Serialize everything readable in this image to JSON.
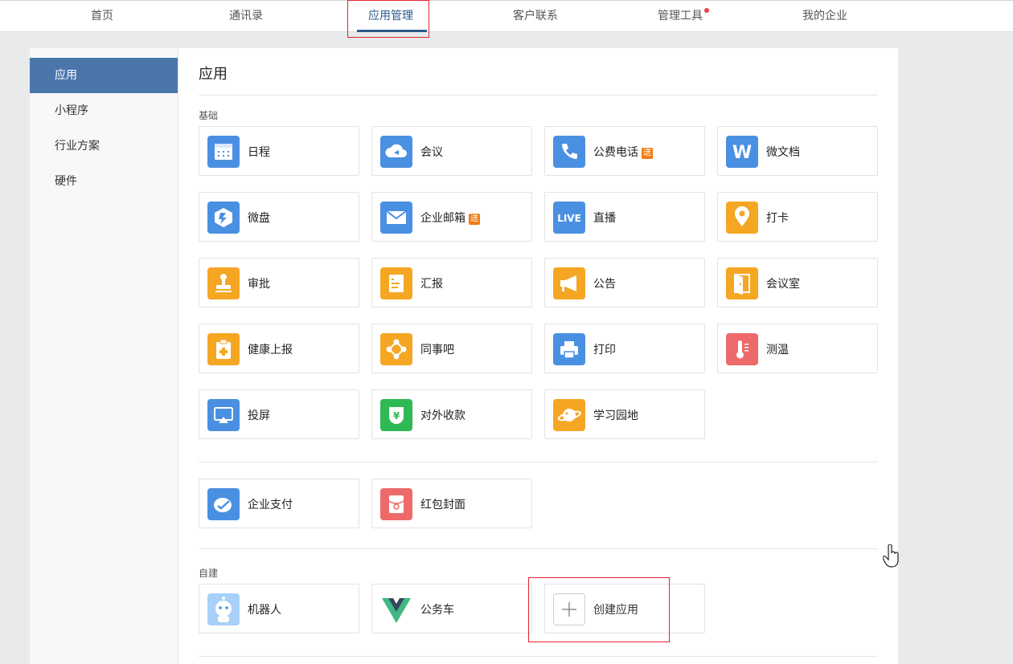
{
  "topnav": {
    "tabs": [
      {
        "label": "首页"
      },
      {
        "label": "通讯录"
      },
      {
        "label": "应用管理"
      },
      {
        "label": "客户联系"
      },
      {
        "label": "管理工具"
      },
      {
        "label": "我的企业"
      }
    ],
    "active_tab": "应用管理"
  },
  "sidebar": {
    "items": [
      {
        "label": "应用"
      },
      {
        "label": "小程序"
      },
      {
        "label": "行业方案"
      },
      {
        "label": "硬件"
      }
    ],
    "active": "应用"
  },
  "main": {
    "title": "应用",
    "sections": {
      "basic": {
        "label": "基础",
        "apps": [
          {
            "name": "日程",
            "icon": "calendar-icon"
          },
          {
            "name": "会议",
            "icon": "cloud-meeting-icon"
          },
          {
            "name": "公费电话",
            "icon": "phone-icon",
            "badge": "送"
          },
          {
            "name": "微文档",
            "icon": "w-doc-icon",
            "glyph": "W"
          },
          {
            "name": "微盘",
            "icon": "drive-icon"
          },
          {
            "name": "企业邮箱",
            "icon": "mail-icon",
            "badge": "送"
          },
          {
            "name": "直播",
            "icon": "live-icon",
            "glyph": "LIVE"
          },
          {
            "name": "打卡",
            "icon": "location-pin-icon"
          },
          {
            "name": "审批",
            "icon": "stamp-icon"
          },
          {
            "name": "汇报",
            "icon": "report-icon"
          },
          {
            "name": "公告",
            "icon": "megaphone-icon"
          },
          {
            "name": "会议室",
            "icon": "door-icon"
          },
          {
            "name": "健康上报",
            "icon": "health-clipboard-icon"
          },
          {
            "name": "同事吧",
            "icon": "network-icon"
          },
          {
            "name": "打印",
            "icon": "printer-icon"
          },
          {
            "name": "测温",
            "icon": "thermometer-icon"
          },
          {
            "name": "投屏",
            "icon": "screen-cast-icon"
          },
          {
            "name": "对外收款",
            "icon": "yuan-shield-icon",
            "glyph": "¥"
          },
          {
            "name": "学习园地",
            "icon": "planet-icon"
          }
        ]
      },
      "payment": {
        "apps": [
          {
            "name": "企业支付",
            "icon": "wecom-pay-icon"
          },
          {
            "name": "红包封面",
            "icon": "red-envelope-icon"
          }
        ]
      },
      "custom": {
        "label": "自建",
        "apps": [
          {
            "name": "机器人",
            "icon": "robot-icon"
          },
          {
            "name": "公务车",
            "icon": "vue-logo-icon"
          },
          {
            "name": "创建应用",
            "icon": "plus-icon"
          }
        ]
      }
    }
  },
  "colors": {
    "accent": "#2b5a8c",
    "sidebar_active": "#4a76ac",
    "icon_blue": "#4a90e2",
    "icon_yellow": "#f5a623",
    "icon_green": "#2fb954",
    "icon_red": "#ee6a6a",
    "badge_orange": "#f27d14",
    "highlight_red": "#e3242b"
  }
}
